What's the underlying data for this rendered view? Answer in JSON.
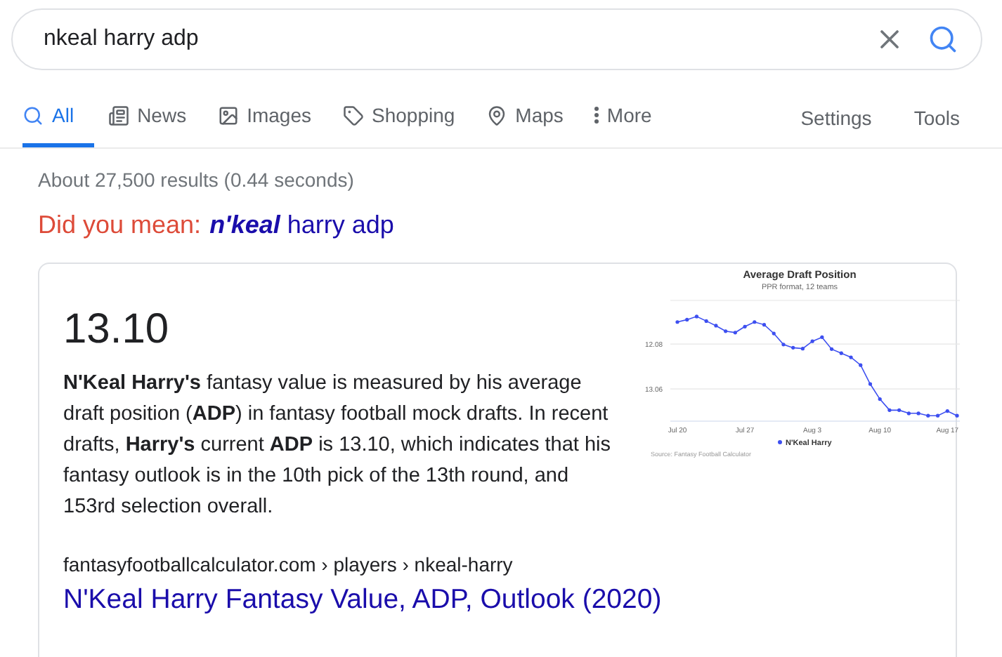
{
  "search": {
    "value": "nkeal harry adp"
  },
  "tabs": [
    {
      "label": "All",
      "kind": "all",
      "selected": true
    },
    {
      "label": "News",
      "kind": "news",
      "selected": false
    },
    {
      "label": "Images",
      "kind": "images",
      "selected": false
    },
    {
      "label": "Shopping",
      "kind": "shopping",
      "selected": false
    },
    {
      "label": "Maps",
      "kind": "maps",
      "selected": false
    },
    {
      "label": "More",
      "kind": "more",
      "selected": false
    }
  ],
  "tools": [
    "Settings",
    "Tools"
  ],
  "result_stats": "About 27,500 results (0.44 seconds)",
  "did_you_mean": {
    "prefix": "Did you mean:",
    "emphasis": "n'keal",
    "rest": "harry adp"
  },
  "snippet": {
    "answer": "13.10",
    "text": "**N'Keal Harry's** fantasy value is measured by his average draft position (**ADP**) in fantasy football mock drafts. In recent drafts, **Harry's** current **ADP** is 13.10, which indicates that his fantasy outlook is in the 10th pick of the 13th round, and 153rd selection overall.",
    "chart_subtitle": "PPR format, 12 teams",
    "chart_source": "Source: Fantasy Football Calculator",
    "chart_data": {
      "type": "line",
      "title": "Average Draft Position",
      "categories": [
        "Jul 20",
        null,
        null,
        null,
        null,
        null,
        null,
        "Jul 27",
        null,
        null,
        null,
        null,
        null,
        null,
        "Aug 3",
        null,
        null,
        null,
        null,
        null,
        null,
        "Aug 10",
        null,
        null,
        null,
        null,
        null,
        null,
        "Aug 17",
        null
      ],
      "yticks": [
        12.08,
        13.06
      ],
      "ylim": [
        13.76,
        11.13
      ],
      "series": [
        {
          "name": "N'Keal Harry",
          "color": "#3d4ff0",
          "values": [
            11.6,
            11.55,
            11.48,
            11.58,
            11.68,
            11.8,
            11.83,
            11.7,
            11.6,
            11.66,
            11.85,
            12.09,
            12.16,
            12.18,
            12.02,
            11.93,
            12.19,
            12.28,
            12.37,
            12.54,
            12.95,
            13.28,
            13.52,
            13.52,
            13.59,
            13.59,
            13.64,
            13.64,
            13.54,
            13.64
          ]
        }
      ]
    },
    "breadcrumb": "fantasyfootballcalculator.com › players › nkeal-harry",
    "link": "N'Keal Harry Fantasy Value, ADP, Outlook (2020)"
  }
}
